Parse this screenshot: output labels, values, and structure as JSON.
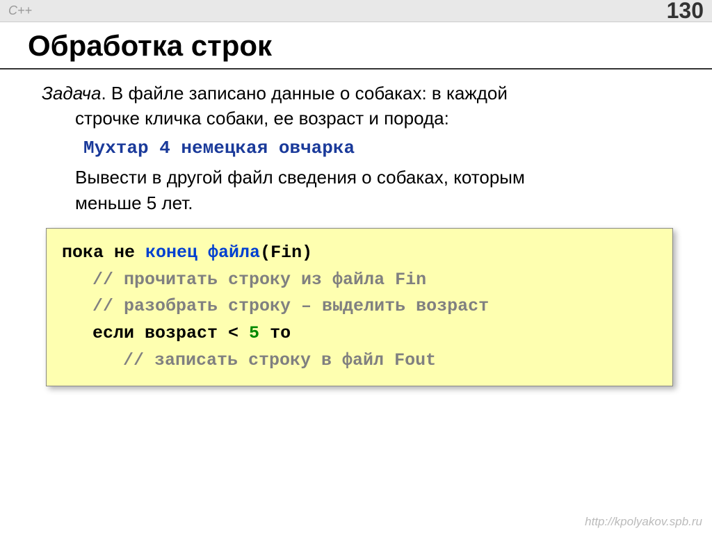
{
  "header": {
    "lang": "C++",
    "page_number": "130"
  },
  "title": "Обработка строк",
  "task": {
    "label": "Задача",
    "text1_a": ". В файле записано данные о собаках: в каждой",
    "text1_b": "строчке кличка собаки, ее возраст и порода:",
    "example": "Мухтар 4 немецкая овчарка",
    "text2_a": "Вывести в другой файл сведения о собаках, которым",
    "text2_b": "меньше 5 лет."
  },
  "code": {
    "line1_a": "пока не ",
    "line1_b": "конец файла",
    "line1_c": "(Fin)",
    "line2": "// прочитать строку из файла Fin",
    "line3": "// разобрать строку – выделить возраст",
    "line4_a": "если возраст < ",
    "line4_b": "5",
    "line4_c": " то",
    "line5": "// записать строку в файл Fout"
  },
  "footer": "http://kpolyakov.spb.ru"
}
